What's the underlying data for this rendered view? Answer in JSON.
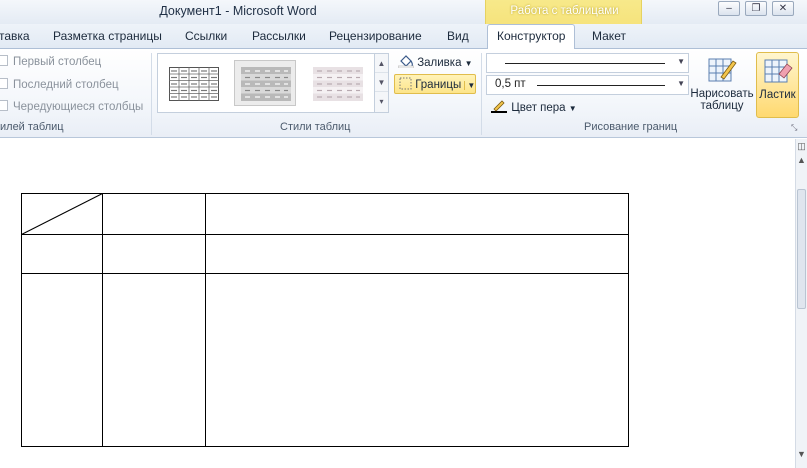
{
  "window": {
    "title": "Документ1  -  Microsoft Word",
    "context_label": "Работа с таблицами",
    "buttons": {
      "minimize": "–",
      "restore": "❐"
    }
  },
  "tabs": [
    {
      "label": "тавка",
      "active": false
    },
    {
      "label": "Разметка страницы",
      "active": false
    },
    {
      "label": "Ссылки",
      "active": false
    },
    {
      "label": "Рассылки",
      "active": false
    },
    {
      "label": "Рецензирование",
      "active": false
    },
    {
      "label": "Вид",
      "active": false
    },
    {
      "label": "Конструктор",
      "active": true
    },
    {
      "label": "Макет",
      "active": false
    }
  ],
  "ribbon": {
    "style_options": {
      "group_label": "илей таблиц",
      "checkboxes": [
        {
          "label": "Первый столбец",
          "checked": false
        },
        {
          "label": "Последний столбец",
          "checked": false
        },
        {
          "label": "Чередующиеся столбцы",
          "checked": false
        }
      ]
    },
    "table_styles": {
      "group_label": "Стили таблиц",
      "shading_label": "Заливка",
      "borders_label": "Границы",
      "gallery_styles": [
        "plain-grid",
        "gray-shaded",
        "light-shaded"
      ]
    },
    "draw_borders": {
      "group_label": "Рисование границ",
      "line_style": "solid",
      "line_weight": "0,5 пт",
      "pen_color_label": "Цвет пера",
      "draw_table_label_1": "Нарисовать",
      "draw_table_label_2": "таблицу",
      "eraser_label": "Ластик"
    }
  },
  "document": {
    "table": {
      "rows": 3,
      "columns": 3,
      "first_cell_diagonal": true,
      "cells": [
        [
          "",
          "",
          ""
        ],
        [
          "",
          "",
          ""
        ],
        [
          "",
          "",
          ""
        ]
      ]
    }
  },
  "colors": {
    "context_band": "#f6e27a",
    "active_button": "#fde58a",
    "ribbon_border": "#aebfd6"
  }
}
